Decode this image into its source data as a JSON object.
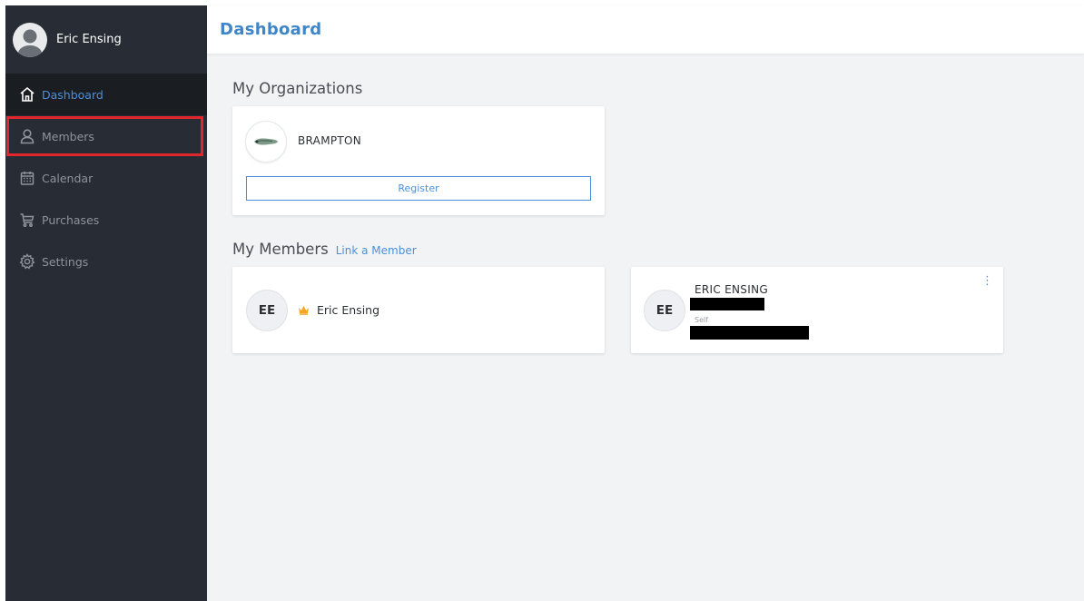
{
  "user": {
    "name": "Eric Ensing"
  },
  "sidebar": {
    "items": [
      {
        "label": "Dashboard",
        "icon": "home-icon"
      },
      {
        "label": "Members",
        "icon": "user-icon"
      },
      {
        "label": "Calendar",
        "icon": "calendar-icon"
      },
      {
        "label": "Purchases",
        "icon": "cart-icon"
      },
      {
        "label": "Settings",
        "icon": "gear-icon"
      }
    ]
  },
  "header": {
    "title": "Dashboard"
  },
  "organizations": {
    "heading": "My Organizations",
    "items": [
      {
        "name": "BRAMPTON",
        "action": "Register"
      }
    ]
  },
  "members": {
    "heading": "My Members",
    "link_label": "Link a Member",
    "cards": [
      {
        "initials": "EE",
        "name": "Eric Ensing"
      },
      {
        "initials": "EE",
        "name": "ERIC ENSING",
        "relation": "Self"
      }
    ]
  },
  "colors": {
    "sidebar_bg": "#282d35",
    "accent": "#4a90d9",
    "highlight_box": "#e1262d",
    "crown": "#f5a623"
  }
}
